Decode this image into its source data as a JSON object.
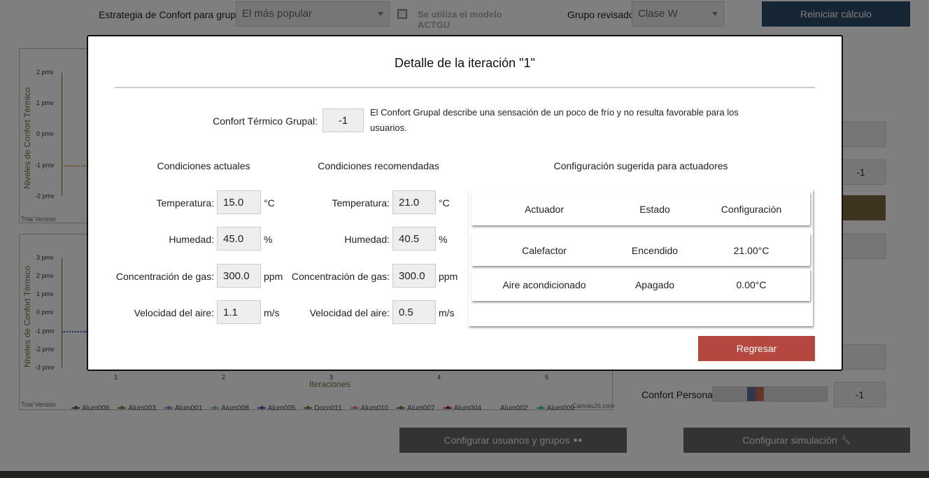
{
  "toolbar": {
    "strategy_label": "Estrategia de Confort para grupos:",
    "strategy_value": "El más popular",
    "actgu_label": "Se utiliza el modelo ACTGU",
    "group_label": "Grupo revisado:",
    "group_value": "Clase W",
    "reset_button": "Reiniciar cálculo"
  },
  "chart_top": {
    "ylabel": "Niveles de Confort Térmico",
    "yticks": [
      "2 pmv",
      "1 pmv",
      "0 pmv",
      "-1 pmv",
      "-2 pmv"
    ],
    "trial": "Trial Version"
  },
  "chart_bottom": {
    "ylabel": "Niveles de Confort Térmico",
    "yticks": [
      "3 pmv",
      "2 pmv",
      "1 pmv",
      "0 pmv",
      "-1 pmv",
      "-2 pmv",
      "-3 pmv"
    ],
    "xticks": [
      "1",
      "2",
      "3",
      "4",
      "5"
    ],
    "xlabel": "Iteraciones",
    "trial": "Trial Version",
    "credit": "CanvasJS.com",
    "legend": [
      {
        "name": "Alum006",
        "color": "#4f6f2f"
      },
      {
        "name": "Alum003",
        "color": "#6a8f3a"
      },
      {
        "name": "Alum001",
        "color": "#8a7fd6"
      },
      {
        "name": "Alum008",
        "color": "#7fbf8f"
      },
      {
        "name": "Alum005",
        "color": "#3a5fbf"
      },
      {
        "name": "Docn011",
        "color": "#5a8f3a"
      },
      {
        "name": "Alum010",
        "color": "#e08a8a"
      },
      {
        "name": "Alum007",
        "color": "#5f7f3f"
      },
      {
        "name": "Alum004",
        "color": "#9f1f6f"
      },
      {
        "name": "Alum002",
        "color": "#ffffff"
      },
      {
        "name": "Alum009",
        "color": "#3fbfbf"
      }
    ]
  },
  "side": {
    "field_value": "-1",
    "personal_label": "Confort Personal:",
    "personal_value": "-1"
  },
  "bottom_buttons": {
    "users": "Configurar usuarios y grupos",
    "simulation": "Configurar simulación"
  },
  "modal": {
    "title": "Detalle de la iteración \"1\"",
    "group_comfort_label": "Confort Térmico Grupal:",
    "group_comfort_value": "-1",
    "description": "El Confort Grupal describe una sensación de un poco de frío y no resulta favorable para los usuarios.",
    "current": {
      "heading": "Condiciones actuales",
      "rows": [
        {
          "label": "Temperatura:",
          "value": "15.0",
          "unit": "°C"
        },
        {
          "label": "Humedad:",
          "value": "45.0",
          "unit": "%"
        },
        {
          "label": "Concentración de gas:",
          "value": "300.0",
          "unit": "ppm"
        },
        {
          "label": "Velocidad del aire:",
          "value": "1.1",
          "unit": "m/s"
        }
      ]
    },
    "recommended": {
      "heading": "Condiciones recomendadas",
      "rows": [
        {
          "label": "Temperatura:",
          "value": "21.0",
          "unit": "°C"
        },
        {
          "label": "Humedad:",
          "value": "40.5",
          "unit": "%"
        },
        {
          "label": "Concentración de gas:",
          "value": "300.0",
          "unit": "ppm"
        },
        {
          "label": "Velocidad del aire:",
          "value": "0.5",
          "unit": "m/s"
        }
      ]
    },
    "actuators": {
      "heading": "Configuración sugerida para actuadores",
      "columns": [
        "Actuador",
        "Estado",
        "Configuración"
      ],
      "rows": [
        [
          "Calefactor",
          "Encendido",
          "21.00°C"
        ],
        [
          "Aire acondicionado",
          "Apagado",
          "0.00°C"
        ]
      ]
    },
    "back_button": "Regresar"
  },
  "colors": {
    "accent_dark": "#2c4a66",
    "back_red": "#b5473e",
    "brown": "#7a6a3f",
    "footer": "#3f4a34"
  }
}
